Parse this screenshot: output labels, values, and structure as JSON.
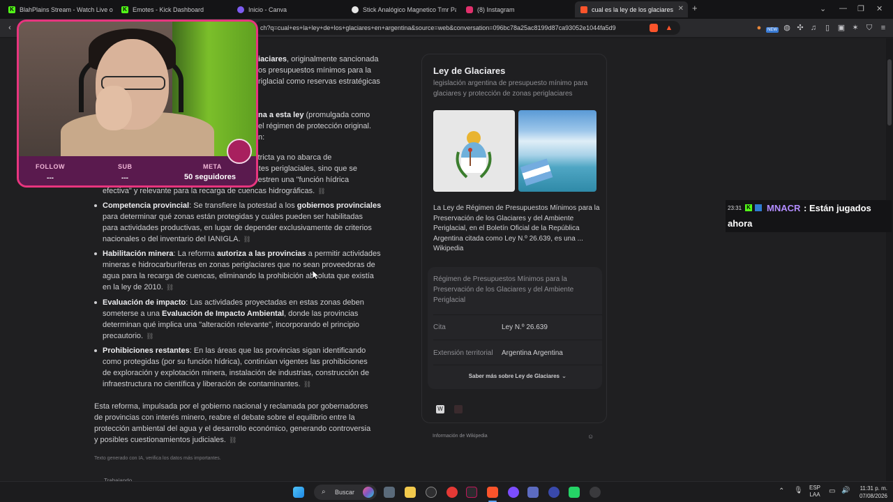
{
  "browser": {
    "tabs": [
      {
        "title": "BlahPlains Stream - Watch Live on Ki",
        "icon": "kick-icon",
        "color": "#53fc18"
      },
      {
        "title": "Emotes - Kick Dashboard",
        "icon": "kick-icon",
        "color": "#53fc18"
      },
      {
        "title": "Inicio - Canva",
        "icon": "canva-icon",
        "color": "#7d5cf0"
      },
      {
        "title": "Stick Analógico Magnetico Tmr Para",
        "icon": "store-icon",
        "color": "#e6e6e6"
      },
      {
        "title": "(8) Instagram",
        "icon": "instagram-icon",
        "color": "#e1306c"
      },
      {
        "title": "cual es la ley de los glaciares en",
        "icon": "brave-icon",
        "color": "#fb542b"
      }
    ],
    "url": "ch?q=cual+es+la+ley+de+los+glaciares+en+argentina&source=web&conversation=096bc78a25ac8199d87ca93052e1044fa5d9",
    "new_badge": "NEW"
  },
  "article": {
    "p1_bold": "iaciares",
    "p1_rest": ", originalmente sancionada",
    "p1_l2": "os presupuestos mínimos para la",
    "p1_l3": "riglacial como reservas estratégicas",
    "p2_bold": "na a esta ley",
    "p2_rest": " (promulgada como",
    "p2_l2": "el régimen de protección original.",
    "p2_l3": "n:",
    "b1": {
      "l1": "Reducción del alcance protector: La ...ción estricta ya no abarca de",
      "l2": "manera amplia a todos los glaciares y ambientes periglaciales, sino que se",
      "l3": "concentra en aquellas formaciones que demuestren una \"función hídrica",
      "l4": "efectiva\" y relevante para la recarga de cuencas hidrográficas."
    },
    "b2": {
      "bold": "Competencia provincial",
      "l1": ": Se transfiere la potestad a los ",
      "bold2": "gobiernos provinciales",
      "l2": "para determinar qué zonas están protegidas y cuáles pueden ser habilitadas",
      "l3": "para actividades productivas, en lugar de depender exclusivamente de criterios",
      "l4": "nacionales o del inventario del IANIGLA."
    },
    "b3": {
      "bold": "Habilitación minera",
      "l1a": ": La reforma ",
      "bold2": "autoriza a las provincias",
      "l1b": " a permitir actividades",
      "l2": "mineras e hidrocarburíferas en zonas periglaciares que no sean proveedoras de",
      "l3": "agua para la recarga de cuencas, eliminando la prohibición absoluta que existía",
      "l4": "en la ley de 2010."
    },
    "b4": {
      "bold": "Evaluación de impacto",
      "l1": ": Las actividades proyectadas en estas zonas deben",
      "l2a": "someterse a una ",
      "bold2": "Evaluación de Impacto Ambiental",
      "l2b": ", donde las provincias",
      "l3": "determinan qué implica una \"alteración relevante\", incorporando el principio",
      "l4": "precautorio."
    },
    "b5": {
      "bold": "Prohibiciones restantes",
      "l1": ": En las áreas que las provincias sigan identificando",
      "l2": "como protegidas (por su función hídrica), continúan vigentes las prohibiciones",
      "l3": "de exploración y explotación minera, instalación de industrias, construcción de",
      "l4": "infraestructura no científica y liberación de contaminantes."
    },
    "closing": {
      "l1": "Esta reforma, impulsada por el gobierno nacional y reclamada por gobernadores",
      "l2": "de provincias con interés minero, reabre el debate sobre el equilibrio entre la",
      "l3": "protección ambiental del agua y el desarrollo económico, generando controversia",
      "l4": "y posibles cuestionamientos judiciales."
    },
    "footnote": "Texto generado con IA, verifica los datos más importantes.",
    "status": "Trabajando"
  },
  "panel": {
    "title": "Ley de Glaciares",
    "subtitle": "legislación argentina de presupuesto mínimo para glaciares y protección de zonas periglaciares",
    "description": "La Ley de Régimen de Presupuestos Mínimos para la Preservación de los Glaciares y del Ambiente Periglacial, en el Boletín Oficial de la República Argentina citada como Ley N.º 26.639, es una ...",
    "description_source": "Wikipedia",
    "full_name": "Régimen de Presupuestos Mínimos para la Preservación de los Glaciares y del Ambiente Periglacial",
    "rows": [
      {
        "key": "Cita",
        "value": "Ley N.º 26.639"
      },
      {
        "key": "Extensión territorial",
        "value": "Argentina Argentina"
      }
    ],
    "more": "Saber más sobre Ley de Glaciares",
    "source_note": "Información de Wikipedia"
  },
  "overlay": {
    "follow_label": "FOLLOW",
    "follow_value": "---",
    "sub_label": "SUB",
    "sub_value": "---",
    "meta_label": "META",
    "meta_value": "50 seguidores"
  },
  "chat": {
    "time": "23:31",
    "user": "MNACR",
    "message_l1": ": Están jugados",
    "message_l2": "ahora",
    "user_color": "#b28cff"
  },
  "taskbar": {
    "search": "Buscar",
    "lang1": "ESP",
    "lang2": "LAA",
    "time": "11:31 p. m.",
    "date": "07/08/2026"
  }
}
